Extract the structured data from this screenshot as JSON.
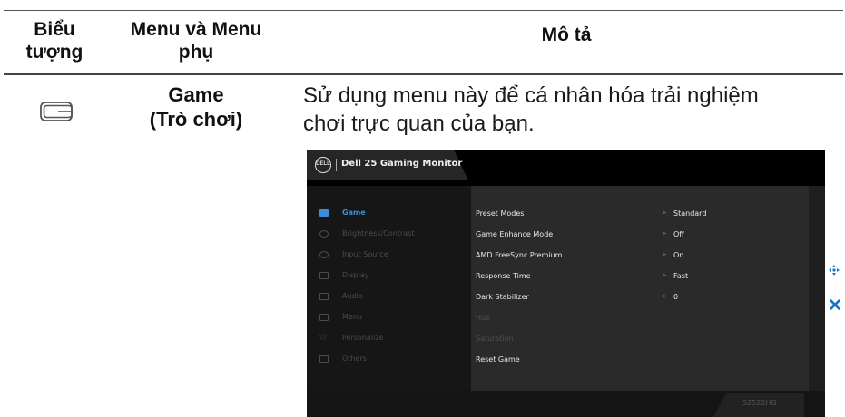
{
  "table": {
    "headers": {
      "icon_line1": "Biểu",
      "icon_line2": "tượng",
      "menu_line1": "Menu và Menu",
      "menu_line2": "phụ",
      "desc": "Mô tả"
    },
    "row": {
      "icon": "game-icon",
      "menu_line1": "Game",
      "menu_line2": "(Trò chơi)",
      "desc_line1": "Sử dụng menu này để cá nhân hóa trải nghiệm",
      "desc_line2": "chơi trực quan của bạn."
    }
  },
  "osd": {
    "logo_text": "DELL",
    "title": "Dell 25 Gaming Monitor",
    "nav": [
      {
        "label": "Game",
        "icon": "game-icon",
        "active": true
      },
      {
        "label": "Brightness/Contrast",
        "icon": "brightness-icon",
        "active": false
      },
      {
        "label": "Input Source",
        "icon": "input-source-icon",
        "active": false
      },
      {
        "label": "Display",
        "icon": "display-icon",
        "active": false
      },
      {
        "label": "Audio",
        "icon": "audio-icon",
        "active": false
      },
      {
        "label": "Menu",
        "icon": "menu-icon",
        "active": false
      },
      {
        "label": "Personalize",
        "icon": "star-icon",
        "active": false
      },
      {
        "label": "Others",
        "icon": "others-icon",
        "active": false
      }
    ],
    "settings": [
      {
        "label": "Preset Modes",
        "value": "Standard",
        "enabled": true
      },
      {
        "label": "Game Enhance Mode",
        "value": "Off",
        "enabled": true
      },
      {
        "label": "AMD FreeSync Premium",
        "value": "On",
        "enabled": true
      },
      {
        "label": "Response Time",
        "value": "Fast",
        "enabled": true
      },
      {
        "label": "Dark Stabilizer",
        "value": "0",
        "enabled": true
      },
      {
        "label": "Hue",
        "value": "",
        "enabled": false
      },
      {
        "label": "Saturation",
        "value": "",
        "enabled": false
      },
      {
        "label": "Reset Game",
        "value": "",
        "enabled": true
      }
    ],
    "model": "S2522HG",
    "side_icons": [
      "move-icon",
      "close-icon"
    ],
    "colors": {
      "accent": "#3a8fd6",
      "side_icon": "#1a73c8"
    }
  }
}
